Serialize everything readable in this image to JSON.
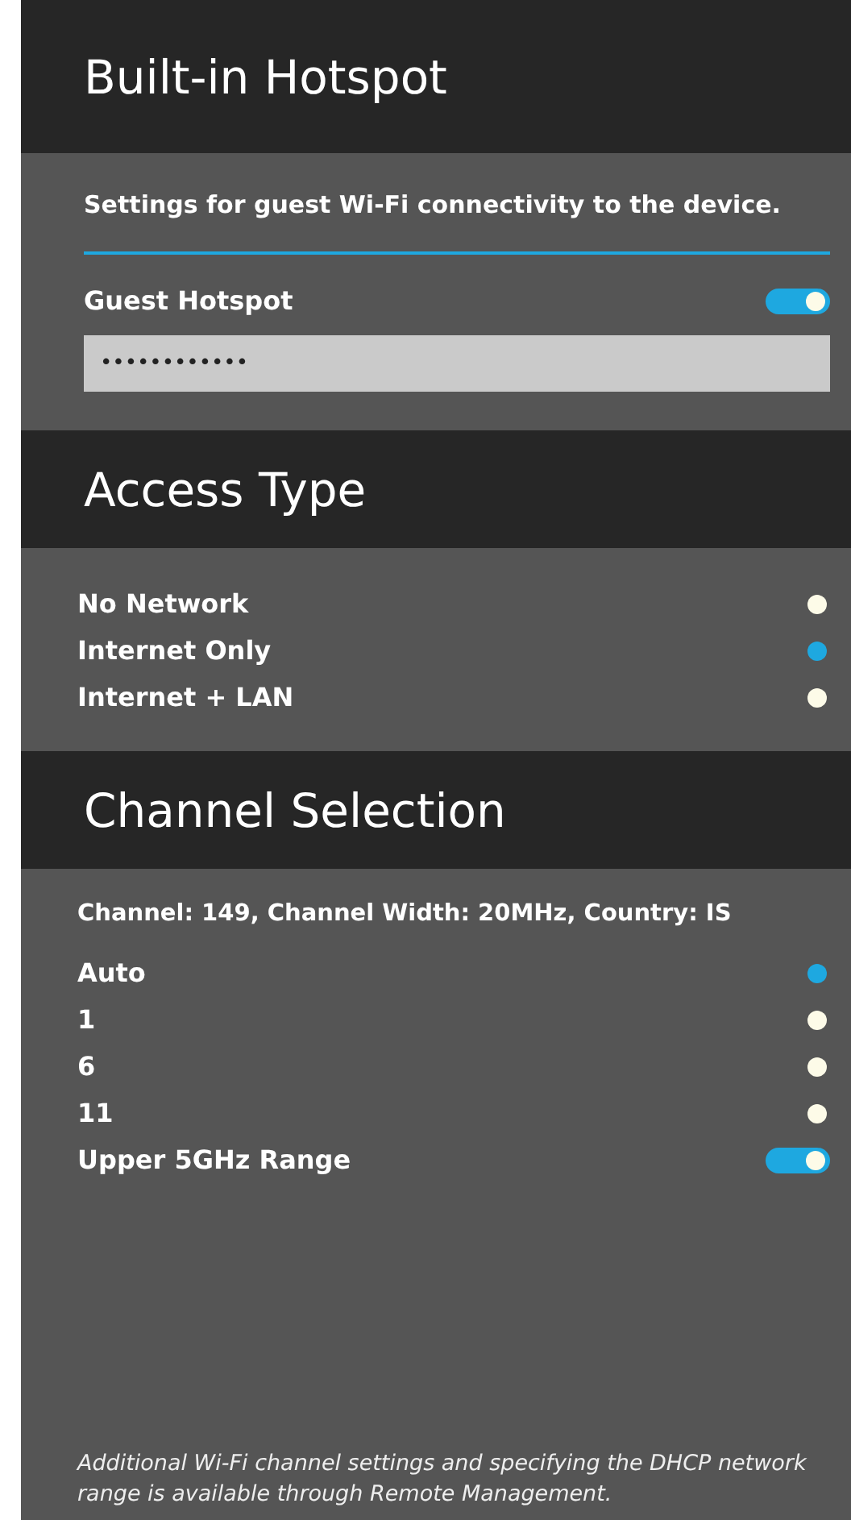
{
  "hotspot": {
    "title": "Built-in Hotspot",
    "description": "Settings for guest Wi-Fi connectivity to the device.",
    "toggle": {
      "label": "Guest Hotspot",
      "on": true
    },
    "password": {
      "value": "••••••••••••"
    }
  },
  "access_type": {
    "title": "Access Type",
    "options": [
      {
        "label": "No Network",
        "selected": false
      },
      {
        "label": "Internet Only",
        "selected": true
      },
      {
        "label": "Internet + LAN",
        "selected": false
      }
    ]
  },
  "channel_selection": {
    "title": "Channel Selection",
    "status": "Channel: 149, Channel Width: 20MHz, Country: IS",
    "items": [
      {
        "kind": "radio",
        "label": "Auto",
        "selected": true
      },
      {
        "kind": "radio",
        "label": "1",
        "selected": false
      },
      {
        "kind": "radio",
        "label": "6",
        "selected": false
      },
      {
        "kind": "radio",
        "label": "11",
        "selected": false
      },
      {
        "kind": "toggle",
        "label": "Upper 5GHz Range",
        "on": true
      }
    ],
    "note": "Additional Wi-Fi channel settings and specifying the DHCP network range is available through Remote Management."
  }
}
